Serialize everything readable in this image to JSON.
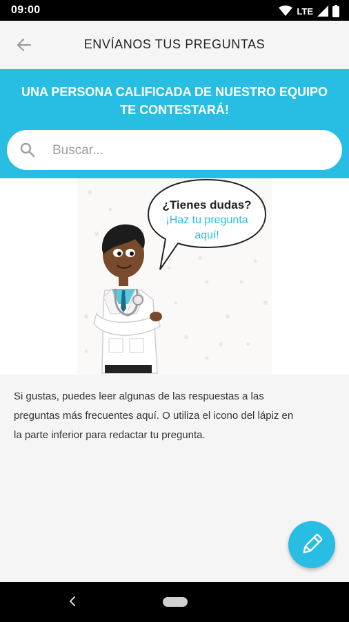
{
  "status_bar": {
    "time": "09:00",
    "network": "LTE"
  },
  "app_bar": {
    "title": "ENVÍANOS TUS PREGUNTAS",
    "back_icon": "arrow-left-icon"
  },
  "banner": {
    "headline_line1": "UNA PERSONA CALIFICADA DE NUESTRO EQUIPO",
    "headline_line2": "TE CONTESTARÁ!"
  },
  "search": {
    "placeholder": "Buscar...",
    "value": "",
    "icon": "search-icon"
  },
  "illustration": {
    "bubble_line1": "¿Tienes dudas?",
    "bubble_line2": "¡Haz tu pregunta",
    "bubble_line3": "aquí!"
  },
  "body": {
    "line1": "Si gustas, puedes leer algunas de las respuestas a las",
    "line2": "preguntas más frecuentes aquí. O utiliza el icono del lápiz en",
    "line3": "la parte inferior para redactar tu pregunta."
  },
  "fab": {
    "icon": "pencil-icon"
  },
  "nav_bar": {
    "back_icon": "chevron-left-icon",
    "home_icon": "home-pill-icon"
  },
  "colors": {
    "accent": "#28bde2",
    "text_dark": "#222222",
    "background": "#f5f5f5"
  }
}
